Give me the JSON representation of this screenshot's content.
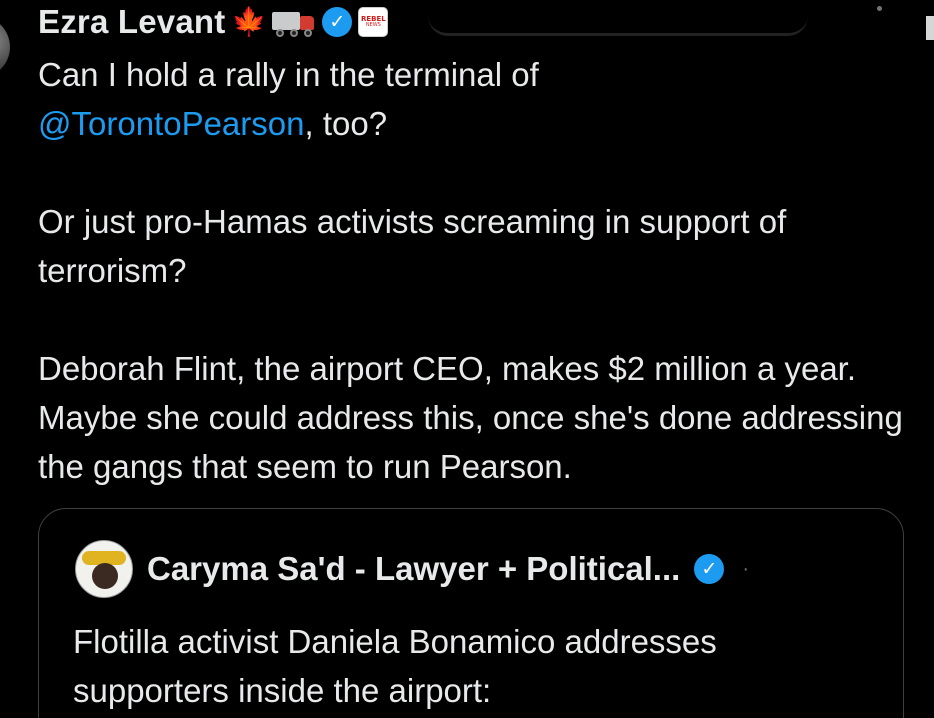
{
  "tweet": {
    "author_name": "Ezra Levant",
    "badges": [
      "maple-leaf-icon",
      "truck-icon",
      "verified-icon",
      "rebel-news-badge"
    ],
    "badge_text": {
      "top": "REBEL",
      "bottom": "NEWS"
    },
    "text_line1": "Can I hold a rally in the terminal of",
    "mention": "@TorontoPearson",
    "text_line1_tail": ", too?",
    "paragraph2": "Or just pro-Hamas activists screaming in support of terrorism?",
    "paragraph3": "Deborah Flint, the airport CEO, makes $2 million a year. Maybe she could address this, once she's done addressing the gangs that seem to run Pearson."
  },
  "quoted_tweet": {
    "author_name": "Caryma Sa'd - Lawyer + Political...",
    "text": "Flotilla activist Daniela Bonamico addresses supporters inside the airport:"
  },
  "colors": {
    "background": "#000000",
    "text": "#e7e9ea",
    "link": "#1d9bf0",
    "verified": "#1d9bf0",
    "border": "#3e4144"
  }
}
